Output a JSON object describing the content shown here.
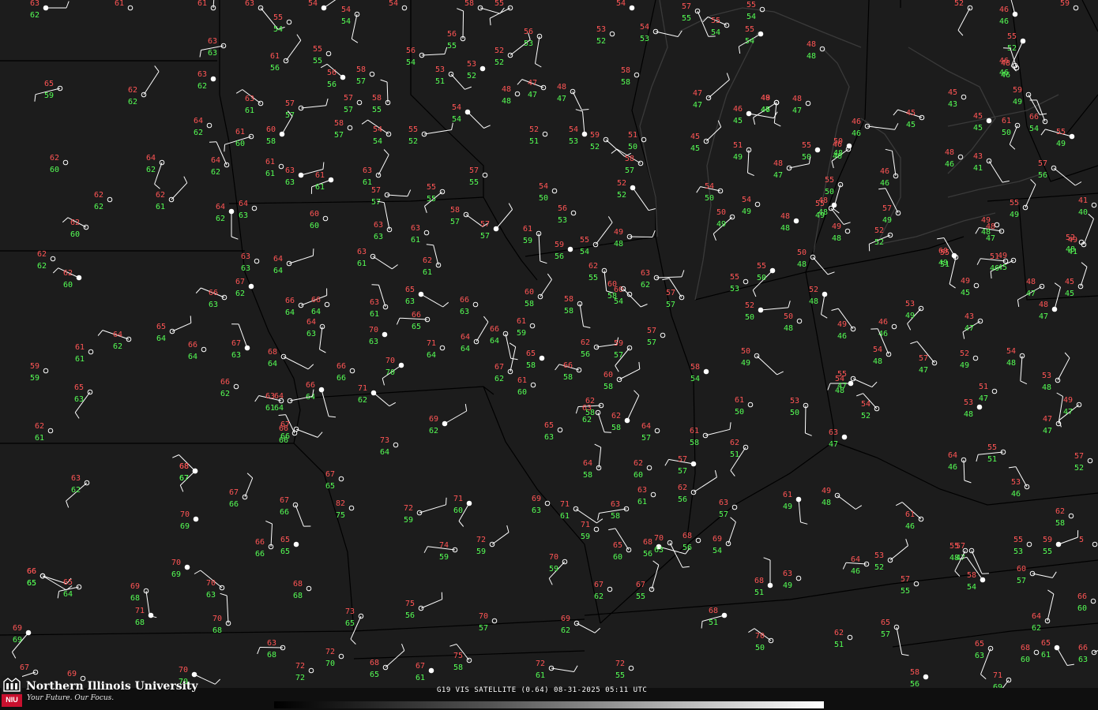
{
  "map": {
    "background": "#1c1c1c",
    "boundary_color": "#000000",
    "temp_color": "#ff5555",
    "dewpoint_color": "#55ff55",
    "symbol_color": "#ffffff",
    "stations": [
      [
        "63",
        "62"
      ],
      [
        "61",
        ""
      ],
      [
        "61",
        ""
      ],
      [
        "63",
        ""
      ],
      [
        "55",
        "54"
      ],
      [
        "54",
        ""
      ],
      [
        "54",
        "54"
      ],
      [
        "54",
        ""
      ],
      [
        "58",
        ""
      ],
      [
        "55",
        ""
      ],
      [
        "54",
        ""
      ],
      [
        "57",
        "55"
      ],
      [
        "55",
        "54"
      ],
      [
        "55",
        "54"
      ],
      [
        "52",
        ""
      ],
      [
        "46",
        "46"
      ],
      [
        "59",
        ""
      ],
      [
        "63",
        "63"
      ],
      [
        "61",
        "56"
      ],
      [
        "55",
        "55"
      ],
      [
        "56",
        "56"
      ],
      [
        "56",
        "54"
      ],
      [
        "58",
        "57"
      ],
      [
        "56",
        "55"
      ],
      [
        "53",
        "51"
      ],
      [
        "53",
        "52"
      ],
      [
        "52",
        "52"
      ],
      [
        "56",
        "53"
      ],
      [
        "53",
        "52"
      ],
      [
        "54",
        "53"
      ],
      [
        "55",
        "54"
      ],
      [
        "48",
        "48"
      ],
      [
        "48",
        "47"
      ],
      [
        "47",
        "47"
      ],
      [
        "46",
        "46"
      ],
      [
        "55",
        "52"
      ],
      [
        "48",
        "46"
      ],
      [
        "58",
        "58"
      ],
      [
        "65",
        "59"
      ],
      [
        "62",
        "62"
      ],
      [
        "63",
        "62"
      ],
      [
        "63",
        "61"
      ],
      [
        "57",
        "57"
      ],
      [
        "57",
        "57"
      ],
      [
        "58",
        "55"
      ],
      [
        "54",
        "54"
      ],
      [
        "48",
        "48"
      ],
      [
        "47",
        "47"
      ],
      [
        "48",
        "47"
      ],
      [
        "48",
        "47"
      ],
      [
        "46",
        "45"
      ],
      [
        "49",
        "46"
      ],
      [
        "45",
        "43"
      ],
      [
        "59",
        "49"
      ],
      [
        "45",
        "45"
      ],
      [
        "45",
        "45"
      ],
      [
        "61",
        "50"
      ],
      [
        "66",
        "54"
      ],
      [
        "64",
        "62"
      ],
      [
        "61",
        "60"
      ],
      [
        "60",
        "58"
      ],
      [
        "58",
        "57"
      ],
      [
        "54",
        "54"
      ],
      [
        "55",
        "52"
      ],
      [
        "52",
        "51"
      ],
      [
        "54",
        "53"
      ],
      [
        "59",
        "52"
      ],
      [
        "51",
        "50"
      ],
      [
        "45",
        "45"
      ],
      [
        "51",
        "49"
      ],
      [
        "55",
        "50"
      ],
      [
        "46",
        "46"
      ],
      [
        "46",
        "46"
      ],
      [
        "48",
        "46"
      ],
      [
        "43",
        "41"
      ],
      [
        "55",
        "49"
      ],
      [
        "62",
        "60"
      ],
      [
        "64",
        "62"
      ],
      [
        "64",
        "62"
      ],
      [
        "61",
        "61"
      ],
      [
        "61",
        "61"
      ],
      [
        "63",
        "61"
      ],
      [
        "57",
        "55"
      ],
      [
        "58",
        "57"
      ],
      [
        "48",
        "47"
      ],
      [
        "50",
        "48"
      ],
      [
        "46",
        "46"
      ],
      [
        "57",
        "56"
      ],
      [
        "62",
        "62"
      ],
      [
        "62",
        "61"
      ],
      [
        "64",
        "62"
      ],
      [
        "64",
        "63"
      ],
      [
        "57",
        "57"
      ],
      [
        "55",
        "55"
      ],
      [
        "54",
        "50"
      ],
      [
        "52",
        "52"
      ],
      [
        "54",
        "50"
      ],
      [
        "54",
        "49"
      ],
      [
        "55",
        "50"
      ],
      [
        "57",
        "49"
      ],
      [
        "48",
        "48"
      ],
      [
        "52",
        "52"
      ],
      [
        "55",
        "49"
      ],
      [
        "41",
        "40"
      ],
      [
        "62",
        "60"
      ],
      [
        "63",
        "63"
      ],
      [
        "60",
        "60"
      ],
      [
        "63",
        "63"
      ],
      [
        "58",
        "57"
      ],
      [
        "63",
        "61"
      ],
      [
        "57",
        "57"
      ],
      [
        "61",
        "59"
      ],
      [
        "56",
        "53"
      ],
      [
        "49",
        "48"
      ],
      [
        "50",
        "49"
      ],
      [
        "48",
        "48"
      ],
      [
        "55",
        "49"
      ],
      [
        "48",
        "47"
      ],
      [
        "52",
        "48"
      ],
      [
        "55",
        "51"
      ],
      [
        "60",
        "49"
      ],
      [
        "49",
        "48"
      ],
      [
        "49",
        "45"
      ],
      [
        "49",
        "41"
      ],
      [
        "62",
        "62"
      ],
      [
        "62",
        "60"
      ],
      [
        "64",
        "64"
      ],
      [
        "63",
        "63"
      ],
      [
        "62",
        "61"
      ],
      [
        "63",
        "61"
      ],
      [
        "59",
        "56"
      ],
      [
        "55",
        "54"
      ],
      [
        "62",
        "55"
      ],
      [
        "60",
        "54"
      ],
      [
        "63",
        "62"
      ],
      [
        "55",
        "50"
      ],
      [
        "49",
        "48"
      ],
      [
        "50",
        "48"
      ],
      [
        "51",
        "46"
      ],
      [
        "55",
        "53"
      ],
      [
        "52",
        "48"
      ],
      [
        "57",
        "57"
      ],
      [
        "49",
        "45"
      ],
      [
        "48",
        "47"
      ],
      [
        "45",
        "45"
      ],
      [
        "67",
        "62"
      ],
      [
        "66",
        "63"
      ],
      [
        "66",
        "64"
      ],
      [
        "66",
        "64"
      ],
      [
        "63",
        "61"
      ],
      [
        "65",
        "63"
      ],
      [
        "66",
        "63"
      ],
      [
        "60",
        "58"
      ],
      [
        "58",
        "58"
      ],
      [
        "61",
        "59"
      ],
      [
        "52",
        "50"
      ],
      [
        "53",
        "49"
      ],
      [
        "50",
        "48"
      ],
      [
        "60",
        "58"
      ],
      [
        "66",
        "65"
      ],
      [
        "70",
        "63"
      ],
      [
        "64",
        "63"
      ],
      [
        "49",
        "46"
      ],
      [
        "46",
        "46"
      ],
      [
        "43",
        "47"
      ],
      [
        "48",
        "47"
      ],
      [
        "61",
        "61"
      ],
      [
        "64",
        "62"
      ],
      [
        "65",
        "64"
      ],
      [
        "66",
        "64"
      ],
      [
        "67",
        "63"
      ],
      [
        "68",
        "64"
      ],
      [
        "71",
        "64"
      ],
      [
        "64",
        "64"
      ],
      [
        "66",
        "64"
      ],
      [
        "65",
        "58"
      ],
      [
        "62",
        "56"
      ],
      [
        "59",
        "57"
      ],
      [
        "57",
        "57"
      ],
      [
        "50",
        "49"
      ],
      [
        "54",
        "48"
      ],
      [
        "52",
        "49"
      ],
      [
        "54",
        "48"
      ],
      [
        "57",
        "47"
      ],
      [
        "59",
        "59"
      ],
      [
        "70",
        "70"
      ],
      [
        "67",
        "62"
      ],
      [
        "61",
        "60"
      ],
      [
        "66",
        "58"
      ],
      [
        "60",
        "58"
      ],
      [
        "58",
        "54"
      ],
      [
        "54",
        "48"
      ],
      [
        "55",
        "47"
      ],
      [
        "51",
        "47"
      ],
      [
        "53",
        "48"
      ],
      [
        "66",
        "64"
      ],
      [
        "66",
        "66"
      ],
      [
        "64",
        "64"
      ],
      [
        "65",
        "63"
      ],
      [
        "66",
        "62"
      ],
      [
        "71",
        "62"
      ],
      [
        "62",
        "58"
      ],
      [
        "61",
        "50"
      ],
      [
        "53",
        "50"
      ],
      [
        "54",
        "52"
      ],
      [
        "53",
        "48"
      ],
      [
        "49",
        "47"
      ],
      [
        "47",
        "47"
      ],
      [
        "62",
        "61"
      ],
      [
        "63",
        "61"
      ],
      [
        "69",
        "62"
      ],
      [
        "65",
        "63"
      ],
      [
        "66",
        "66"
      ],
      [
        "67",
        "66"
      ],
      [
        "73",
        "64"
      ],
      [
        "62",
        "58"
      ],
      [
        "63",
        "62"
      ],
      [
        "64",
        "57"
      ],
      [
        "61",
        "58"
      ],
      [
        "62",
        "51"
      ],
      [
        "63",
        "47"
      ],
      [
        "49",
        "48"
      ],
      [
        "55",
        "51"
      ],
      [
        "57",
        "52"
      ],
      [
        "64",
        "46"
      ],
      [
        "68",
        "67"
      ],
      [
        "67",
        "65"
      ],
      [
        "63",
        "62"
      ],
      [
        "64",
        "58"
      ],
      [
        "62",
        "60"
      ],
      [
        "57",
        "57"
      ],
      [
        "62",
        "56"
      ],
      [
        "63",
        "61"
      ],
      [
        "53",
        "46"
      ],
      [
        "66",
        "65"
      ],
      [
        "70",
        "69"
      ],
      [
        "67",
        "66"
      ],
      [
        "67",
        "66"
      ],
      [
        "82",
        "75"
      ],
      [
        "72",
        "59"
      ],
      [
        "71",
        "60"
      ],
      [
        "69",
        "63"
      ],
      [
        "71",
        "61"
      ],
      [
        "63",
        "58"
      ],
      [
        "63",
        "57"
      ],
      [
        "61",
        "49"
      ],
      [
        "61",
        "46"
      ],
      [
        "62",
        "58"
      ],
      [
        "68",
        "67"
      ],
      [
        "66",
        "66"
      ],
      [
        "65",
        "65"
      ],
      [
        "74",
        "59"
      ],
      [
        "72",
        "59"
      ],
      [
        "71",
        "59"
      ],
      [
        "65",
        "60"
      ],
      [
        "68",
        "56"
      ],
      [
        "68",
        "56"
      ],
      [
        "69",
        "54"
      ],
      [
        "57",
        "47"
      ],
      [
        "55",
        "53"
      ],
      [
        "59",
        "55"
      ],
      [
        "55",
        "48"
      ],
      [
        "5",
        ""
      ],
      [
        "66",
        "65"
      ],
      [
        "65",
        "64"
      ],
      [
        "70",
        "69"
      ],
      [
        "69",
        "68"
      ],
      [
        "70",
        "63"
      ],
      [
        "68",
        "68"
      ],
      [
        "70",
        "59"
      ],
      [
        "68",
        "51"
      ],
      [
        "63",
        "49"
      ],
      [
        "64",
        "46"
      ],
      [
        "53",
        "52"
      ],
      [
        "57",
        "55"
      ],
      [
        "58",
        "54"
      ],
      [
        "60",
        "57"
      ],
      [
        "67",
        "62"
      ],
      [
        "67",
        "55"
      ],
      [
        "70",
        "63"
      ],
      [
        "71",
        "68"
      ],
      [
        "75",
        "56"
      ],
      [
        "73",
        "65"
      ],
      [
        "70",
        "57"
      ],
      [
        "69",
        "62"
      ],
      [
        "68",
        "51"
      ],
      [
        "62",
        "51"
      ],
      [
        "65",
        "57"
      ],
      [
        "70",
        "50"
      ],
      [
        "66",
        "60"
      ],
      [
        "69",
        "69"
      ],
      [
        "70",
        "68"
      ],
      [
        "72",
        "70"
      ],
      [
        "63",
        "68"
      ],
      [
        "68",
        "65"
      ],
      [
        "67",
        "61"
      ],
      [
        "75",
        "58"
      ],
      [
        "72",
        "61"
      ],
      [
        "72",
        "55"
      ],
      [
        "64",
        "62"
      ],
      [
        "65",
        "61"
      ],
      [
        "68",
        "60"
      ],
      [
        "66",
        "63"
      ],
      [
        "65",
        "63"
      ],
      [
        "72",
        "72"
      ],
      [
        "70",
        "70"
      ],
      [
        "67",
        ""
      ],
      [
        "69",
        ""
      ],
      [
        "71",
        ""
      ],
      [
        "70",
        ""
      ],
      [
        "58",
        "56"
      ],
      [
        "71",
        "69"
      ]
    ]
  },
  "branding": {
    "logo_text": "NIU",
    "university_name": "Northern Illinois University",
    "tagline": "Your Future. Our Focus."
  },
  "caption": {
    "text": "G19 VIS SATELLITE (0.64) 08-31-2025 05:11 UTC"
  },
  "colorbar": {
    "colors": [
      "#000000",
      "#555555",
      "#bbbbbb",
      "#ffffff"
    ]
  }
}
